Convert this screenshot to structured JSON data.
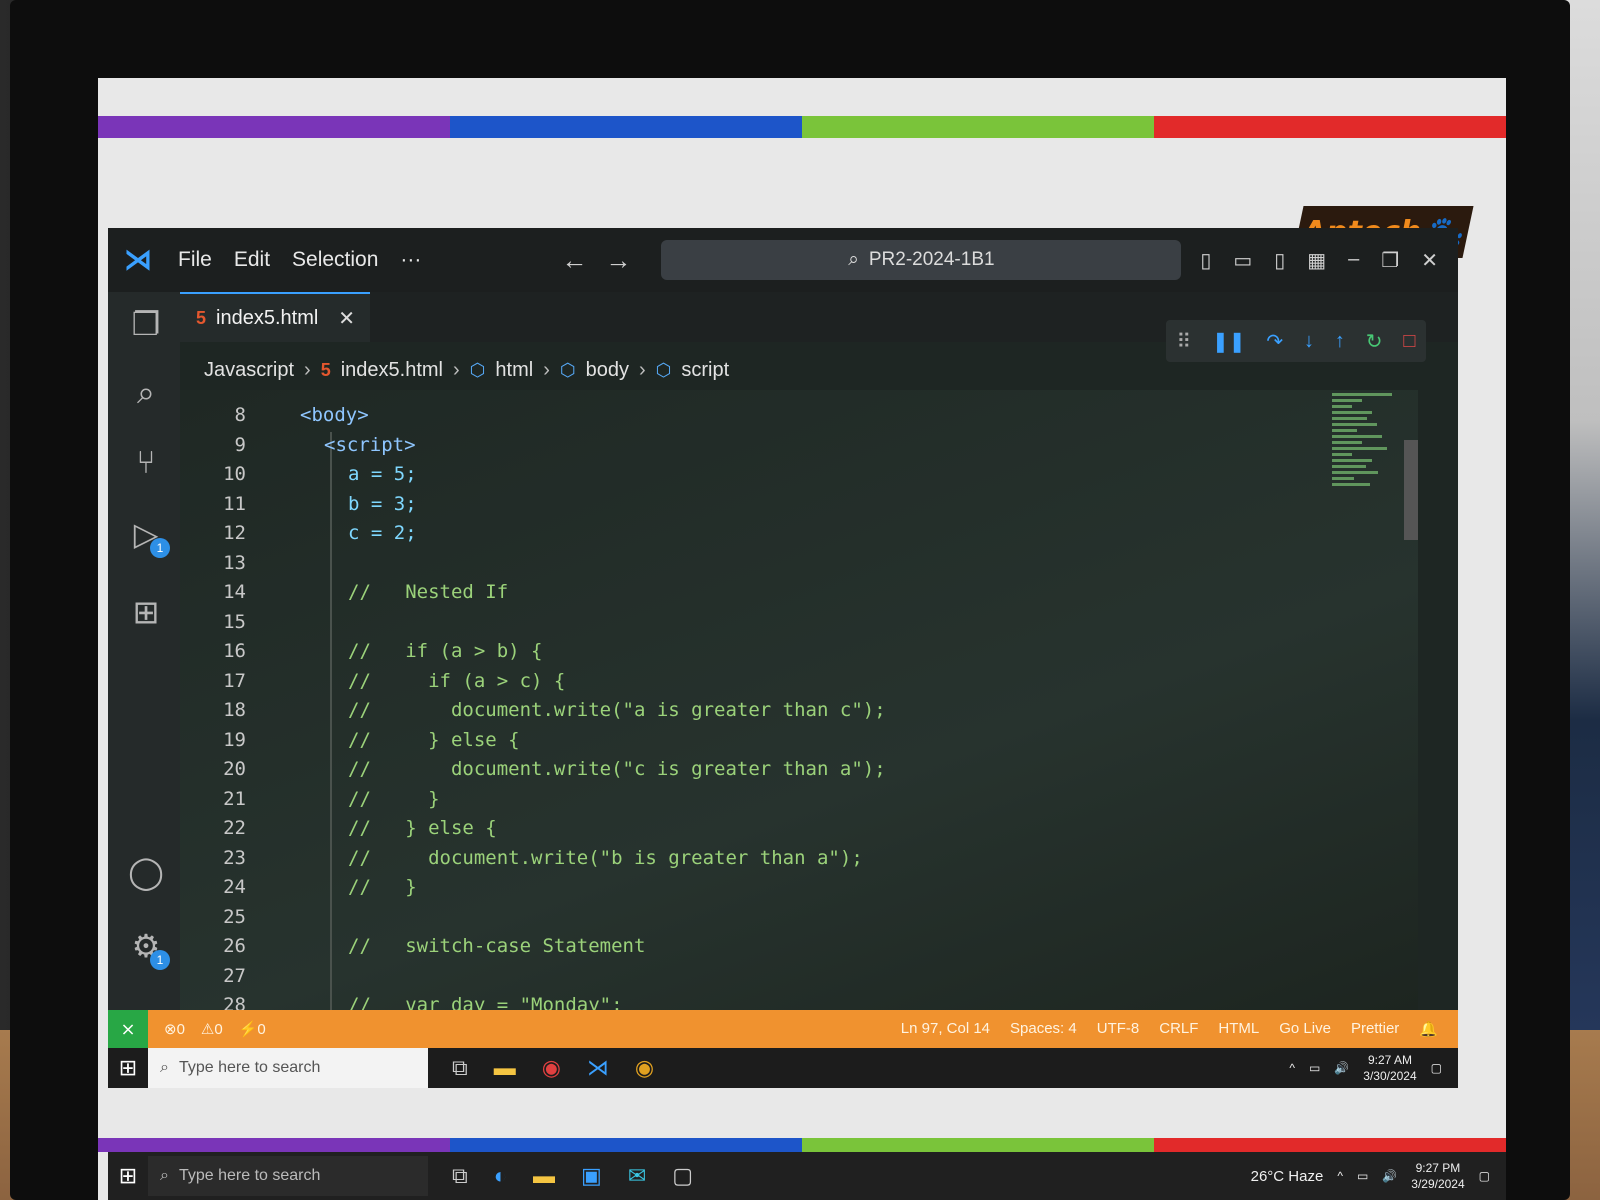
{
  "menu": {
    "file": "File",
    "edit": "Edit",
    "selection": "Selection",
    "more": "···"
  },
  "search_text": "PR2-2024-1B1",
  "logo_text": "Aptech",
  "tab": {
    "filename": "index5.html",
    "close": "✕"
  },
  "breadcrumbs": [
    "Javascript",
    "index5.html",
    "html",
    "body",
    "script"
  ],
  "code_lines": [
    {
      "num": "8",
      "text": "<body>"
    },
    {
      "num": "9",
      "text": "<script>"
    },
    {
      "num": "10",
      "text": "a = 5;"
    },
    {
      "num": "11",
      "text": "b = 3;"
    },
    {
      "num": "12",
      "text": "c = 2;"
    },
    {
      "num": "13",
      "text": ""
    },
    {
      "num": "14",
      "text": "//   Nested If"
    },
    {
      "num": "15",
      "text": ""
    },
    {
      "num": "16",
      "text": "//   if (a > b) {"
    },
    {
      "num": "17",
      "text": "//     if (a > c) {"
    },
    {
      "num": "18",
      "text": "//       document.write(\"a is greater than c\");"
    },
    {
      "num": "19",
      "text": "//     } else {"
    },
    {
      "num": "20",
      "text": "//       document.write(\"c is greater than a\");"
    },
    {
      "num": "21",
      "text": "//     }"
    },
    {
      "num": "22",
      "text": "//   } else {"
    },
    {
      "num": "23",
      "text": "//     document.write(\"b is greater than a\");"
    },
    {
      "num": "24",
      "text": "//   }"
    },
    {
      "num": "25",
      "text": ""
    },
    {
      "num": "26",
      "text": "//   switch-case Statement"
    },
    {
      "num": "27",
      "text": ""
    },
    {
      "num": "28",
      "text": "//   var day = \"Monday\";"
    }
  ],
  "activity_badges": {
    "run": "1",
    "settings": "1"
  },
  "statusbar": {
    "errors": "0",
    "warnings": "0",
    "ports": "0",
    "position": "Ln 97, Col 14",
    "spaces": "Spaces: 4",
    "encoding": "UTF-8",
    "eol": "CRLF",
    "language": "HTML",
    "golive": "Go Live",
    "prettier": "Prettier"
  },
  "taskbar": {
    "search_placeholder": "Type here to search",
    "time": "9:27 AM",
    "date": "3/30/2024"
  },
  "taskbar2": {
    "search_placeholder": "Type here to search",
    "weather": "26°C  Haze",
    "time": "9:27 PM",
    "date": "3/29/2024"
  },
  "colors": {
    "stripe": [
      "#7a35b8",
      "#1d55c9",
      "#7ac43a",
      "#e22a2a"
    ],
    "statusbar": "#f0922f",
    "accent": "#3aa0ff"
  }
}
